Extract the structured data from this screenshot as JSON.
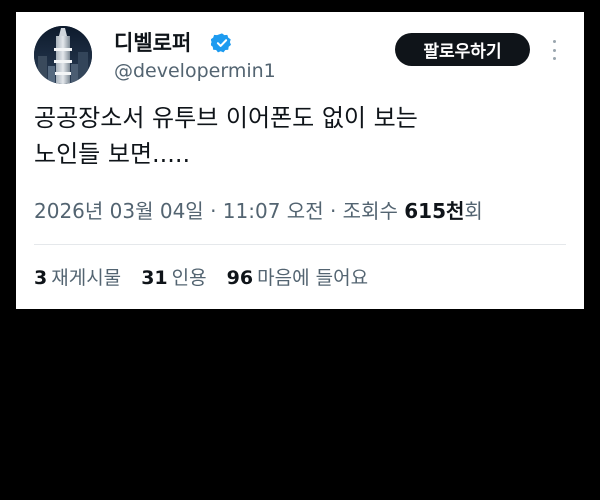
{
  "tweet": {
    "author": {
      "display_name": "디벨로퍼",
      "handle": "@developermin1",
      "verified": true,
      "avatar_icon": "building-photo"
    },
    "follow_label": "팔로우하기",
    "more_icon": "more-vertical-icon",
    "text_lines": [
      "공공장소서 유투브 이어폰도 없이 보는",
      "노인들 보면....."
    ],
    "meta": {
      "date": "2026년 03월 04일",
      "separator": " · ",
      "time": "11:07 오전",
      "views_label": "조회수",
      "views_count": "615천",
      "views_suffix": "회"
    },
    "stats": {
      "reposts_count": "3",
      "reposts_label": "재게시물",
      "quotes_count": "31",
      "quotes_label": "인용",
      "likes_count": "96",
      "likes_label": "마음에 들어요"
    }
  },
  "colors": {
    "background": "#000000",
    "card": "#ffffff",
    "text_primary": "#0f1419",
    "text_secondary": "#536471",
    "verified": "#1d9bf0",
    "button": "#0f1419"
  }
}
